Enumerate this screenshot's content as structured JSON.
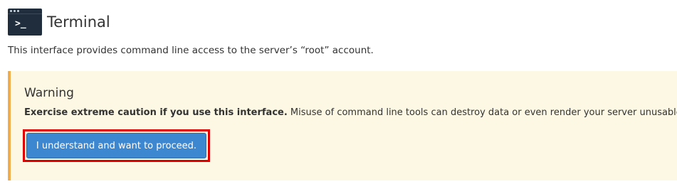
{
  "header": {
    "icon": "terminal-icon",
    "icon_prompt": ">_",
    "title": "Terminal"
  },
  "description": "This interface provides command line access to the server’s “root” account.",
  "warning": {
    "title": "Warning",
    "emphasis": "Exercise extreme caution if you use this interface.",
    "message": " Misuse of command line tools can destroy data or even render your server unusable.",
    "button_label": "I understand and want to proceed."
  },
  "colors": {
    "warning_background": "#fcf8e3",
    "warning_border": "#f0ad4e",
    "button_background": "#3d87d1",
    "highlight": "#e00000"
  }
}
